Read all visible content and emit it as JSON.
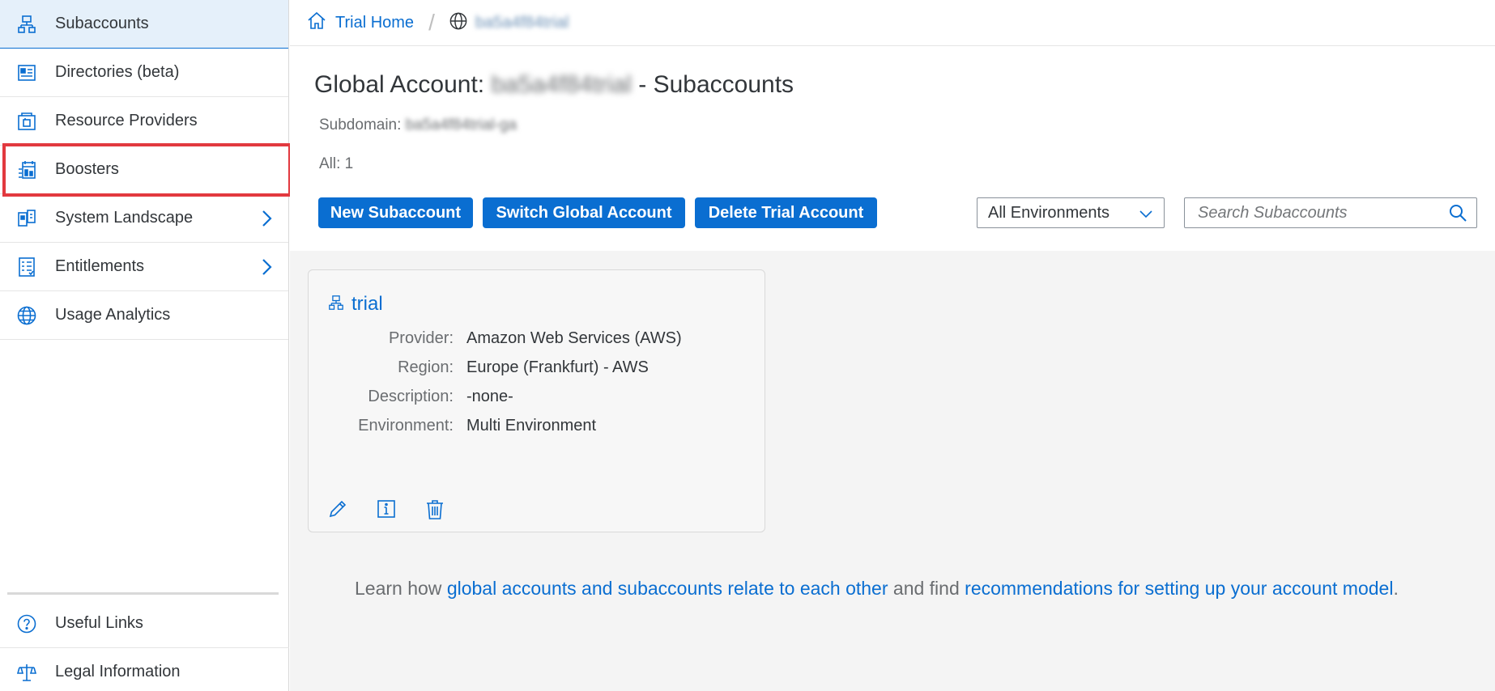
{
  "sidebar": {
    "items": [
      {
        "label": "Subaccounts",
        "icon": "subaccount-icon",
        "selected": true
      },
      {
        "label": "Directories (beta)",
        "icon": "directory-icon"
      },
      {
        "label": "Resource Providers",
        "icon": "resource-provider-icon"
      },
      {
        "label": "Boosters",
        "icon": "booster-icon"
      },
      {
        "label": "System Landscape",
        "icon": "system-landscape-icon",
        "expandable": true
      },
      {
        "label": "Entitlements",
        "icon": "entitlements-icon",
        "expandable": true
      },
      {
        "label": "Usage Analytics",
        "icon": "globe-icon"
      }
    ],
    "bottom_items": [
      {
        "label": "Useful Links",
        "icon": "help-icon"
      },
      {
        "label": "Legal Information",
        "icon": "scales-icon"
      }
    ]
  },
  "breadcrumb": {
    "home": "Trial Home",
    "separator": "/",
    "account": "ba5a4f84trial"
  },
  "page": {
    "title_prefix": "Global Account: ",
    "title_account": "ba5a4f84trial",
    "title_suffix": " - Subaccounts",
    "subdomain_label": "Subdomain: ",
    "subdomain_value": "ba5a4f84trial-ga",
    "count": "All: 1"
  },
  "toolbar": {
    "new_label": "New Subaccount",
    "switch_label": "Switch Global Account",
    "delete_label": "Delete Trial Account",
    "env_selected": "All Environments",
    "search_placeholder": "Search Subaccounts"
  },
  "card": {
    "name": "trial",
    "fields": [
      {
        "key": "Provider:",
        "value": "Amazon Web Services (AWS)"
      },
      {
        "key": "Region:",
        "value": "Europe (Frankfurt) - AWS"
      },
      {
        "key": "Description:",
        "value": "-none-"
      },
      {
        "key": "Environment:",
        "value": "Multi Environment"
      }
    ]
  },
  "learn": {
    "prefix": "Learn how ",
    "link1": "global accounts and subaccounts relate to each other",
    "middle": " and find ",
    "link2": "recommendations for setting up your account model",
    "suffix": "."
  },
  "colors": {
    "accent": "#0a6ed1",
    "highlight": "#e2393f",
    "selected_bg": "#e5f0fa"
  }
}
